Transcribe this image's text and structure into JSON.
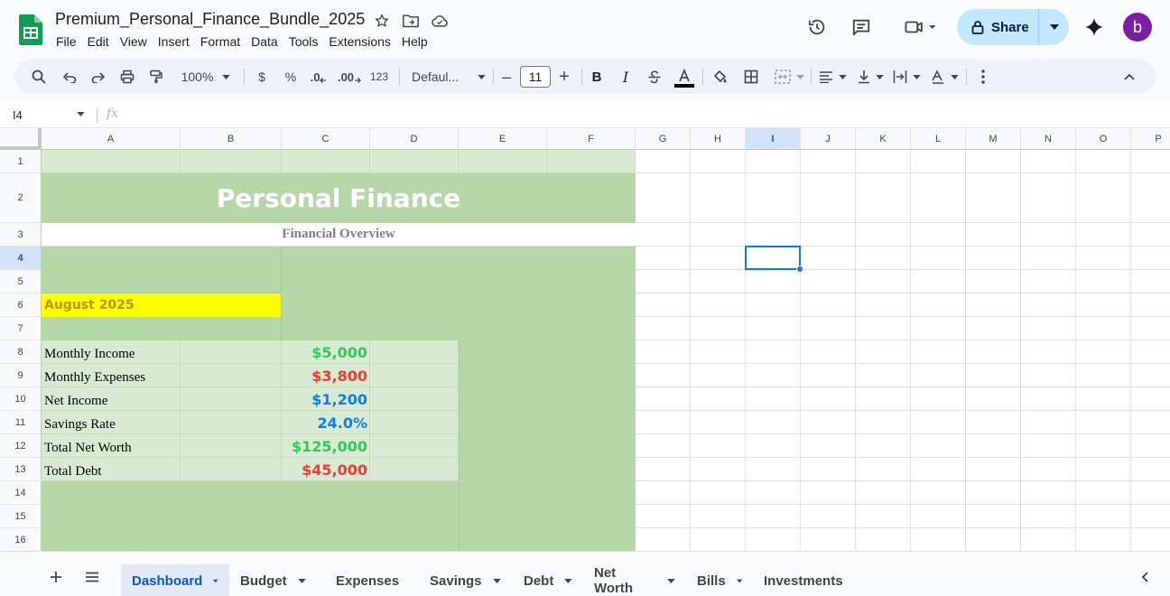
{
  "document": {
    "title": "Premium_Personal_Finance_Bundle_2025"
  },
  "menu": [
    "File",
    "Edit",
    "View",
    "Insert",
    "Format",
    "Data",
    "Tools",
    "Extensions",
    "Help"
  ],
  "share": {
    "label": "Share"
  },
  "user": {
    "avatar_letter": "b",
    "avatar_color": "#7b1fa2"
  },
  "toolbar": {
    "zoom": "100%",
    "currency": "$",
    "percent": "%",
    "dec_decrease": ".0",
    "dec_increase": ".00",
    "number_format": "123",
    "font": "Defaul...",
    "font_size": "11",
    "minus": "–",
    "plus": "+",
    "bold": "B",
    "italic": "I"
  },
  "formula_bar": {
    "cell_ref": "I4",
    "fx": "fx"
  },
  "grid": {
    "columns": [
      "A",
      "B",
      "C",
      "D",
      "E",
      "F",
      "G",
      "H",
      "I",
      "J",
      "K",
      "L",
      "M",
      "N",
      "O",
      "P"
    ],
    "rows": [
      "1",
      "2",
      "3",
      "4",
      "5",
      "6",
      "7",
      "8",
      "9",
      "10",
      "11",
      "12",
      "13",
      "14",
      "15",
      "16"
    ],
    "selected_column": "I",
    "selected_row": "4"
  },
  "sheet": {
    "title": "Personal Finance",
    "subtitle": "Financial Overview",
    "period": "August 2025",
    "metrics": [
      {
        "label": "Monthly Income",
        "value": "$5,000",
        "color": "#34c759"
      },
      {
        "label": "Monthly Expenses",
        "value": "$3,800",
        "color": "#f23b30"
      },
      {
        "label": "Net Income",
        "value": "$1,200",
        "color": "#0a7ff5"
      },
      {
        "label": "Savings Rate",
        "value": "24.0%",
        "color": "#0a7ff5"
      },
      {
        "label": "Total Net Worth",
        "value": "$125,000",
        "color": "#34c759"
      },
      {
        "label": "Total Debt",
        "value": "$45,000",
        "color": "#f23b30"
      }
    ],
    "colors": {
      "dark_green": "#b6d7a8",
      "light_green": "#d9ead3",
      "period_bg": "#ffff00",
      "period_text": "#bf9000",
      "subtitle_text": "#7f7f7f"
    }
  },
  "tabs": [
    "Dashboard",
    "Budget",
    "Expenses",
    "Savings",
    "Debt",
    "Net Worth",
    "Bills",
    "Investments"
  ],
  "active_tab": "Dashboard"
}
